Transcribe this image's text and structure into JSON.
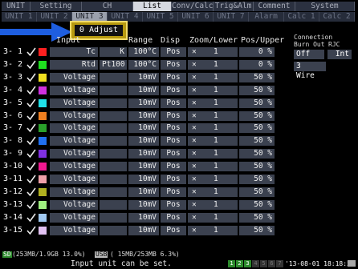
{
  "tabs_top": [
    "UNIT",
    "Setting",
    "CH",
    "List",
    "Conv/Calc",
    "Trig&Alm",
    "Comment",
    "System"
  ],
  "tabs_top_selected": 3,
  "tabs_sub": [
    "UNIT 1",
    "UNIT 2",
    "UNIT 3",
    "UNIT 4",
    "UNIT 5",
    "UNIT 6",
    "UNIT 7",
    "Alarm",
    "Calc 1",
    "Calc 2"
  ],
  "tabs_sub_selected": 2,
  "callout": "0 Adjust",
  "header": {
    "input": "Input",
    "range": "Range",
    "disp": "Disp",
    "zoom_lower": "Zoom/Lower",
    "pos_upper": "Pos/Upper"
  },
  "connection": {
    "title": "Connection",
    "burn_out_label": "Burn Out",
    "rjc_label": "RJC",
    "burn_out_value": "Off",
    "rjc_value": "Int",
    "wire": "3 Wire"
  },
  "rows": [
    {
      "ch": "3- 1",
      "color": "#ff2020",
      "input": "Tc",
      "type": "K",
      "range": "100°C",
      "disp": "Pos",
      "zoom": "1",
      "pos": "0 %"
    },
    {
      "ch": "3- 2",
      "color": "#1fe01f",
      "input": "Rtd",
      "type": "Pt100",
      "range": "100°C",
      "disp": "Pos",
      "zoom": "1",
      "pos": "0 %"
    },
    {
      "ch": "3- 3",
      "color": "#f0e020",
      "input": "Voltage",
      "type": "",
      "range": "10mV",
      "disp": "Pos",
      "zoom": "1",
      "pos": "50 %"
    },
    {
      "ch": "3- 4",
      "color": "#d030e0",
      "input": "Voltage",
      "type": "",
      "range": "10mV",
      "disp": "Pos",
      "zoom": "1",
      "pos": "50 %"
    },
    {
      "ch": "3- 5",
      "color": "#20e0e8",
      "input": "Voltage",
      "type": "",
      "range": "10mV",
      "disp": "Pos",
      "zoom": "1",
      "pos": "50 %"
    },
    {
      "ch": "3- 6",
      "color": "#f08020",
      "input": "Voltage",
      "type": "",
      "range": "10mV",
      "disp": "Pos",
      "zoom": "1",
      "pos": "50 %"
    },
    {
      "ch": "3- 7",
      "color": "#2aa02a",
      "input": "Voltage",
      "type": "",
      "range": "10mV",
      "disp": "Pos",
      "zoom": "1",
      "pos": "50 %"
    },
    {
      "ch": "3- 8",
      "color": "#2070f0",
      "input": "Voltage",
      "type": "",
      "range": "10mV",
      "disp": "Pos",
      "zoom": "1",
      "pos": "50 %"
    },
    {
      "ch": "3- 9",
      "color": "#8030e0",
      "input": "Voltage",
      "type": "",
      "range": "10mV",
      "disp": "Pos",
      "zoom": "1",
      "pos": "50 %"
    },
    {
      "ch": "3-10",
      "color": "#f01890",
      "input": "Voltage",
      "type": "",
      "range": "10mV",
      "disp": "Pos",
      "zoom": "1",
      "pos": "50 %"
    },
    {
      "ch": "3-11",
      "color": "#f0a0a8",
      "input": "Voltage",
      "type": "",
      "range": "10mV",
      "disp": "Pos",
      "zoom": "1",
      "pos": "50 %"
    },
    {
      "ch": "3-12",
      "color": "#b0b020",
      "input": "Voltage",
      "type": "",
      "range": "10mV",
      "disp": "Pos",
      "zoom": "1",
      "pos": "50 %"
    },
    {
      "ch": "3-13",
      "color": "#a0f080",
      "input": "Voltage",
      "type": "",
      "range": "10mV",
      "disp": "Pos",
      "zoom": "1",
      "pos": "50 %"
    },
    {
      "ch": "3-14",
      "color": "#a0c8f0",
      "input": "Voltage",
      "type": "",
      "range": "10mV",
      "disp": "Pos",
      "zoom": "1",
      "pos": "50 %"
    },
    {
      "ch": "3-15",
      "color": "#e0c0f0",
      "input": "Voltage",
      "type": "",
      "range": "10mV",
      "disp": "Pos",
      "zoom": "1",
      "pos": "50 %"
    }
  ],
  "status": {
    "media1_icon": "SD",
    "media1": "(253MB/1.9GB 13.0%)",
    "media2_icon": "USB",
    "media2": "( 15MB/253MB  6.3%)",
    "message": "Input unit can be set.",
    "unit_nums": [
      "1",
      "2",
      "3",
      "4",
      "5",
      "6",
      "7"
    ],
    "datetime": "'13-08-01 18:18:56"
  },
  "colors": {
    "accent_arrow": "#1e5ee0",
    "callout_border": "#f2dc6a",
    "cell_bg": "#3b414f"
  }
}
